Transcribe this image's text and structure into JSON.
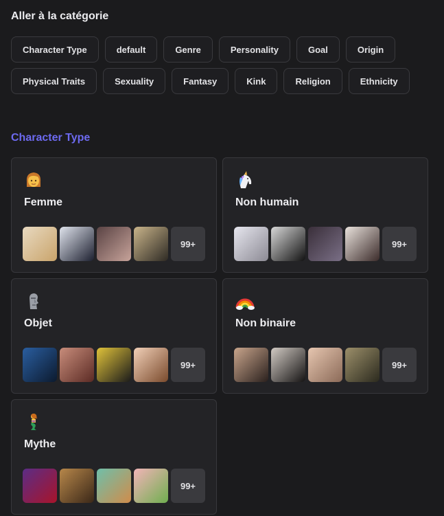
{
  "header": {
    "title": "Aller à la catégorie"
  },
  "chips": [
    {
      "label": "Character Type"
    },
    {
      "label": "default"
    },
    {
      "label": "Genre"
    },
    {
      "label": "Personality"
    },
    {
      "label": "Goal"
    },
    {
      "label": "Origin"
    },
    {
      "label": "Physical Traits"
    },
    {
      "label": "Sexuality"
    },
    {
      "label": "Fantasy"
    },
    {
      "label": "Kink"
    },
    {
      "label": "Religion"
    },
    {
      "label": "Ethnicity"
    }
  ],
  "section": {
    "title": "Character Type",
    "accent": "#6d6af0"
  },
  "cards": [
    {
      "title": "Femme",
      "icon": "woman-emoji-icon",
      "more": "99+",
      "thumbs": [
        {
          "c1": "#e8d9c0",
          "c2": "#c9a46b"
        },
        {
          "c1": "#dfe3ec",
          "c2": "#1d2030"
        },
        {
          "c1": "#5a4344",
          "c2": "#c7a39a"
        },
        {
          "c1": "#c9b48a",
          "c2": "#2e2a24"
        }
      ]
    },
    {
      "title": "Non humain",
      "icon": "unicorn-emoji-icon",
      "more": "99+",
      "thumbs": [
        {
          "c1": "#e6e6ee",
          "c2": "#8c8a94"
        },
        {
          "c1": "#d8d8d8",
          "c2": "#111111"
        },
        {
          "c1": "#3a2f3a",
          "c2": "#7a6f86"
        },
        {
          "c1": "#e9e2dc",
          "c2": "#3b2b2a"
        }
      ]
    },
    {
      "title": "Objet",
      "icon": "moai-emoji-icon",
      "more": "99+",
      "thumbs": [
        {
          "c1": "#2a5ea0",
          "c2": "#0c1a2e"
        },
        {
          "c1": "#c88d7b",
          "c2": "#5b2a24"
        },
        {
          "c1": "#e0c23a",
          "c2": "#1b1b1b"
        },
        {
          "c1": "#f1d0b8",
          "c2": "#7a4a2c"
        }
      ]
    },
    {
      "title": "Non binaire",
      "icon": "rainbow-emoji-icon",
      "more": "99+",
      "thumbs": [
        {
          "c1": "#c9a58c",
          "c2": "#2a201d"
        },
        {
          "c1": "#d2cbc4",
          "c2": "#151313"
        },
        {
          "c1": "#e6c6b0",
          "c2": "#8b6a58"
        },
        {
          "c1": "#9c8f6a",
          "c2": "#2b2a1e"
        }
      ]
    },
    {
      "title": "Mythe",
      "icon": "mermaid-emoji-icon",
      "more": "99+",
      "thumbs": [
        {
          "c1": "#5b2d86",
          "c2": "#a8142a"
        },
        {
          "c1": "#b7874a",
          "c2": "#3a2718"
        },
        {
          "c1": "#6fbfa9",
          "c2": "#d08c4b"
        },
        {
          "c1": "#f2b4b8",
          "c2": "#6fae4f"
        }
      ]
    }
  ]
}
